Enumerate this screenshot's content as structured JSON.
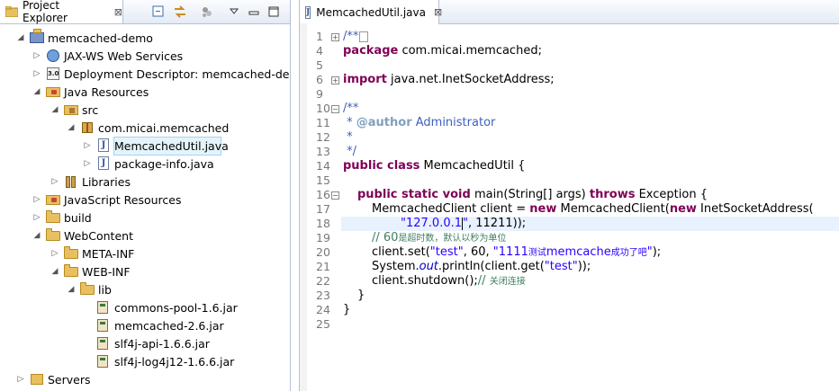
{
  "left_panel": {
    "tab_title": "Project Explorer",
    "close_glyph": "⊠",
    "toolbar": [
      "collapse-all-icon",
      "link-with-editor-icon",
      "view-menu-dots-icon",
      "view-menu-icon",
      "minimize-icon",
      "maximize-icon"
    ],
    "tree": [
      {
        "label": "memcached-demo",
        "icon": "project-icon",
        "expanded": true
      },
      {
        "label": "JAX-WS Web Services",
        "icon": "web-services-icon",
        "expanded": false
      },
      {
        "label": "Deployment Descriptor: memcached-dem",
        "icon": "deployment-descriptor-icon",
        "expanded": false
      },
      {
        "label": "Java Resources",
        "icon": "java-resources-icon",
        "expanded": true
      },
      {
        "label": "src",
        "icon": "source-folder-icon",
        "expanded": true
      },
      {
        "label": "com.micai.memcached",
        "icon": "package-icon",
        "expanded": true
      },
      {
        "label": "MemcachedUtil.java",
        "icon": "java-file-icon",
        "expanded": false,
        "selected": true
      },
      {
        "label": "package-info.java",
        "icon": "java-file-icon",
        "expanded": false
      },
      {
        "label": "Libraries",
        "icon": "libraries-icon",
        "expanded": false
      },
      {
        "label": "JavaScript Resources",
        "icon": "javascript-resources-icon",
        "expanded": false
      },
      {
        "label": "build",
        "icon": "folder-icon",
        "expanded": false
      },
      {
        "label": "WebContent",
        "icon": "folder-icon",
        "expanded": true
      },
      {
        "label": "META-INF",
        "icon": "folder-icon",
        "expanded": false
      },
      {
        "label": "WEB-INF",
        "icon": "folder-icon",
        "expanded": true
      },
      {
        "label": "lib",
        "icon": "folder-icon",
        "expanded": true
      },
      {
        "label": "commons-pool-1.6.jar",
        "icon": "jar-icon"
      },
      {
        "label": "memcached-2.6.jar",
        "icon": "jar-icon"
      },
      {
        "label": "slf4j-api-1.6.6.jar",
        "icon": "jar-icon"
      },
      {
        "label": "slf4j-log4j12-1.6.6.jar",
        "icon": "jar-icon"
      },
      {
        "label": "Servers",
        "icon": "servers-icon",
        "expanded": false
      }
    ]
  },
  "editor": {
    "tab_title": "MemcachedUtil.java",
    "close_glyph": "⊠",
    "line_numbers": [
      "1",
      "4",
      "5",
      "6",
      "9",
      "10",
      "11",
      "12",
      "13",
      "14",
      "15",
      "16",
      "17",
      "18",
      "19",
      "20",
      "21",
      "22",
      "23",
      "24",
      "25"
    ],
    "folded_markers": [
      "+",
      "+",
      "−",
      "−"
    ],
    "code": {
      "l1": "/**",
      "l4_kw": "package",
      "l4_rest": " com.micai.memcached;",
      "l6_kw": "import",
      "l6_rest": " java.net.InetSocketAddress;",
      "l10": "/**",
      "l11_pre": " * ",
      "l11_tag": "@author",
      "l11_rest": " Administrator",
      "l12": " *",
      "l13": " */",
      "l14_kw": "public class",
      "l14_rest": " MemcachedUtil {",
      "l16_kw1": "public static void",
      "l16_mid": " main(String[] args) ",
      "l16_kw2": "throws",
      "l16_rest": " Exception {",
      "l17_a": "MemcachedClient client = ",
      "l17_kw": "new",
      "l17_b": " MemcachedClient(",
      "l17_kw2": "new",
      "l17_c": " InetSocketAddress(",
      "l18_str": "\"127.0.0.1",
      "l18_str2": "\"",
      "l18_rest": ", 11211));",
      "l19_cm": "// 60",
      "l19_cn": "是超时数，默认以秒为单位",
      "l20_a": "client.set(",
      "l20_s1": "\"test\"",
      "l20_b": ", 60, ",
      "l20_s2": "\"1111",
      "l20_s2cn": "测试",
      "l20_s3": "memcache",
      "l20_s3cn": "成功了吧",
      "l20_s4": "\"",
      "l20_c": ");",
      "l21_a": "System.",
      "l21_out": "out",
      "l21_b": ".println(client.get(",
      "l21_s": "\"test\"",
      "l21_c": "));",
      "l22_a": "client.shutdown();",
      "l22_cm": "// ",
      "l22_cn": "关闭连接",
      "l23": "}",
      "l24": "}"
    }
  }
}
